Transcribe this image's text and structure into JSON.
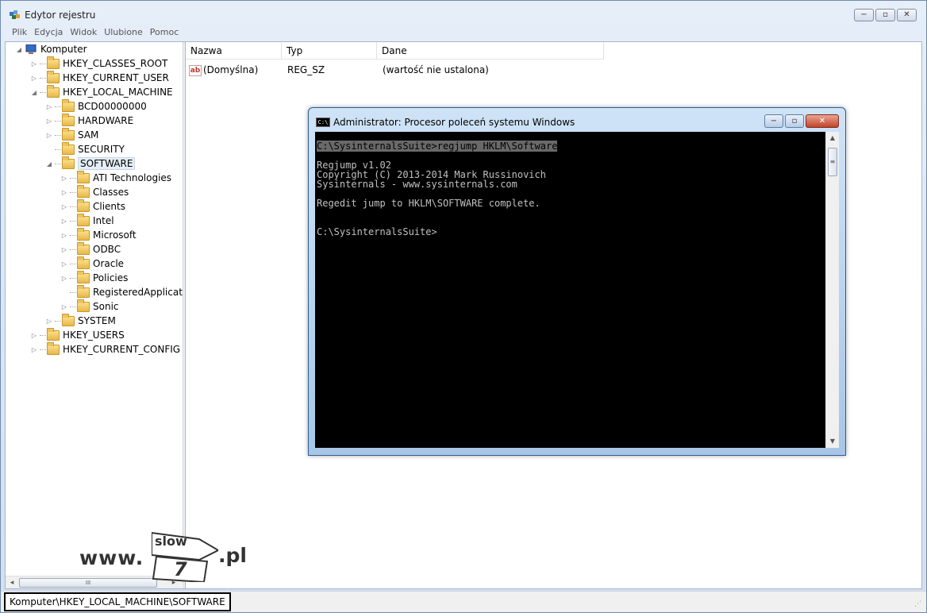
{
  "app": {
    "title": "Edytor rejestru"
  },
  "menu": [
    "Plik",
    "Edycja",
    "Widok",
    "Ulubione",
    "Pomoc"
  ],
  "window_controls": {
    "minimize": "−",
    "maximize": "▫",
    "close": "✕"
  },
  "tree": {
    "root": "Komputer",
    "items": [
      {
        "label": "HKEY_CLASSES_ROOT",
        "level": 1,
        "expander": "▷"
      },
      {
        "label": "HKEY_CURRENT_USER",
        "level": 1,
        "expander": "▷"
      },
      {
        "label": "HKEY_LOCAL_MACHINE",
        "level": 1,
        "expander": "◢"
      },
      {
        "label": "BCD00000000",
        "level": 2,
        "expander": "▷"
      },
      {
        "label": "HARDWARE",
        "level": 2,
        "expander": "▷"
      },
      {
        "label": "SAM",
        "level": 2,
        "expander": "▷"
      },
      {
        "label": "SECURITY",
        "level": 2,
        "expander": ""
      },
      {
        "label": "SOFTWARE",
        "level": 2,
        "expander": "◢",
        "selected": true
      },
      {
        "label": "ATI Technologies",
        "level": 3,
        "expander": "▷"
      },
      {
        "label": "Classes",
        "level": 3,
        "expander": "▷"
      },
      {
        "label": "Clients",
        "level": 3,
        "expander": "▷"
      },
      {
        "label": "Intel",
        "level": 3,
        "expander": "▷"
      },
      {
        "label": "Microsoft",
        "level": 3,
        "expander": "▷"
      },
      {
        "label": "ODBC",
        "level": 3,
        "expander": "▷"
      },
      {
        "label": "Oracle",
        "level": 3,
        "expander": "▷"
      },
      {
        "label": "Policies",
        "level": 3,
        "expander": "▷"
      },
      {
        "label": "RegisteredApplications",
        "level": 3,
        "expander": ""
      },
      {
        "label": "Sonic",
        "level": 3,
        "expander": "▷"
      },
      {
        "label": "SYSTEM",
        "level": 2,
        "expander": "▷"
      },
      {
        "label": "HKEY_USERS",
        "level": 1,
        "expander": "▷"
      },
      {
        "label": "HKEY_CURRENT_CONFIG",
        "level": 1,
        "expander": "▷"
      }
    ]
  },
  "list": {
    "columns": [
      "Nazwa",
      "Typ",
      "Dane"
    ],
    "rows": [
      {
        "icon": "ab",
        "name": "(Domyślna)",
        "type": "REG_SZ",
        "data": "(wartość nie ustalona)"
      }
    ]
  },
  "statusbar": {
    "path": "Komputer\\HKEY_LOCAL_MACHINE\\SOFTWARE"
  },
  "hscroll": {
    "left": "◂",
    "right": "▸",
    "grip": "III"
  },
  "cmd": {
    "title": "Administrator: Procesor poleceń systemu Windows",
    "icon_label": "C:\\",
    "lines": [
      {
        "text": "C:\\SysinternalsSuite>regjump HKLM\\Software",
        "highlight": true
      },
      {
        "text": ""
      },
      {
        "text": "Regjump v1.02"
      },
      {
        "text": "Copyright (C) 2013-2014 Mark Russinovich"
      },
      {
        "text": "Sysinternals - www.sysinternals.com"
      },
      {
        "text": ""
      },
      {
        "text": "Regedit jump to HKLM\\SOFTWARE complete."
      },
      {
        "text": ""
      },
      {
        "text": ""
      },
      {
        "text": "C:\\SysinternalsSuite>"
      }
    ],
    "scroll": {
      "up": "▲",
      "down": "▼",
      "grip": "≡"
    }
  },
  "watermark": {
    "prefix": "www.",
    "top": "slow",
    "digit": "7",
    "suffix": ".pl"
  },
  "colors": {
    "accent": "#2f5f8f",
    "console_bg": "#000000",
    "console_fg": "#c0c0c0",
    "selection": "#e5edf7"
  }
}
